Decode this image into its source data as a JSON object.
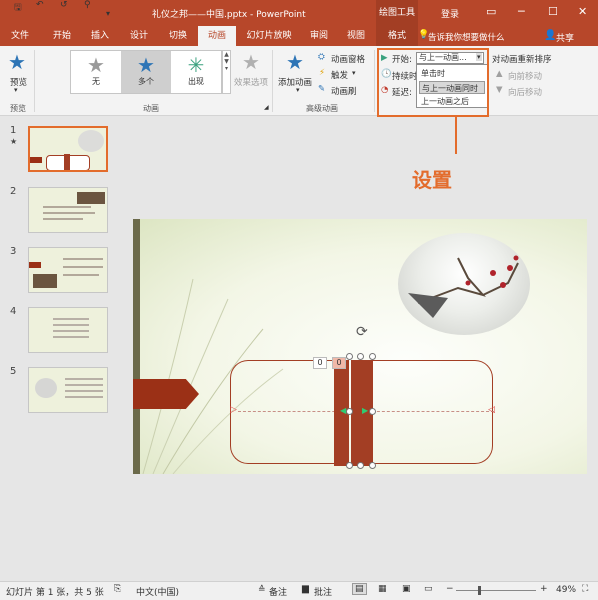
{
  "title_bar": {
    "doc_title": "礼仪之邦——中国.pptx - PowerPoint",
    "context_group": "绘图工具",
    "login": "登录",
    "qa_icons": [
      "save-icon",
      "undo-icon",
      "redo-icon",
      "customize-icon"
    ],
    "win_icons": [
      "ribbon-display-icon",
      "minimize-icon",
      "maximize-icon",
      "close-icon"
    ]
  },
  "tabs": [
    "文件",
    "开始",
    "插入",
    "设计",
    "切换",
    "动画",
    "幻灯片放映",
    "审阅",
    "视图",
    "格式"
  ],
  "active_tab": "动画",
  "tell_me": "告诉我你想要做什么",
  "share": "共享",
  "ribbon": {
    "preview": {
      "button": "预览",
      "group": "预览"
    },
    "animation": {
      "gallery": [
        {
          "label": "无",
          "color": "#9a9a9a"
        },
        {
          "label": "多个",
          "color": "#2e75b6"
        },
        {
          "label": "出现",
          "color": "#3aa17e"
        }
      ],
      "effect_options": "效果选项",
      "group": "动画"
    },
    "advanced": {
      "add_animation": "添加动画",
      "pane": "动画窗格",
      "trigger": "触发",
      "painter": "动画刷",
      "group": "高级动画"
    },
    "timing": {
      "start_label": "开始:",
      "start_value": "与上一动画...",
      "duration_label": "持续时",
      "delay_label": "延迟:",
      "options": [
        "单击时",
        "与上一动画同时",
        "上一动画之后"
      ],
      "selected_option": "与上一动画同时",
      "reorder": "对动画重新排序",
      "move_earlier": "向前移动",
      "move_later": "向后移动"
    }
  },
  "callout": "设置",
  "slides": [
    {
      "num": "1",
      "marker": "★"
    },
    {
      "num": "2"
    },
    {
      "num": "3"
    },
    {
      "num": "4"
    },
    {
      "num": "5"
    }
  ],
  "slide_tags": [
    "0",
    "0"
  ],
  "status": {
    "slide_info": "幻灯片 第 1 张，共 5 张",
    "language": "中文(中国)",
    "notes": "备注",
    "comments": "批注",
    "zoom": "49%"
  },
  "colors": {
    "brand": "#b7472a",
    "highlight": "#e36c2c",
    "accent_scroll": "#a33e24"
  }
}
